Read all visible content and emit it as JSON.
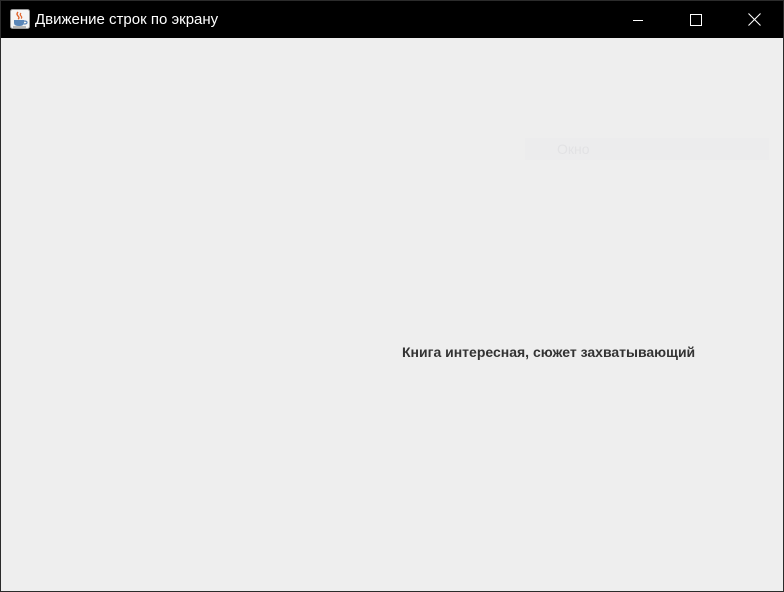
{
  "window": {
    "title": "Движение строк по экрану",
    "app_icon": "java-cup-icon",
    "controls": {
      "minimize_icon": "minimize-icon",
      "maximize_icon": "maximize-icon",
      "close_icon": "close-icon"
    }
  },
  "content": {
    "faded_label": "Окно",
    "moving_text": "Книга интересная, сюжет захватывающий"
  },
  "colors": {
    "titlebar": "#000000",
    "background": "#eeeeee",
    "text": "#333333",
    "faded_text": "#e2e2e4"
  }
}
